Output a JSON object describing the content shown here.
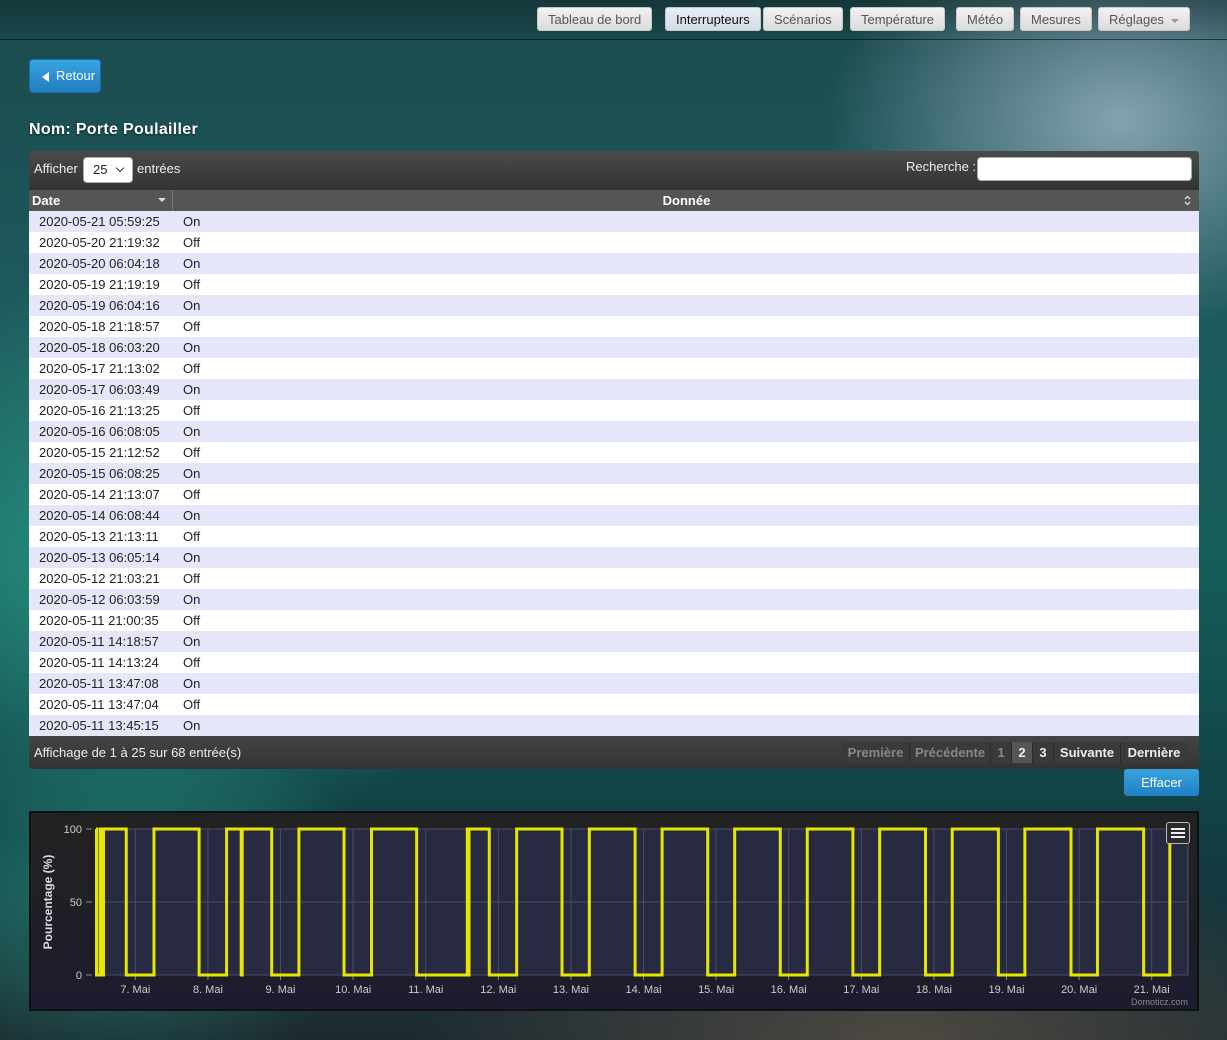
{
  "nav": {
    "items": [
      {
        "label": "Tableau de bord",
        "active": false
      },
      {
        "label": "Interrupteurs",
        "active": true
      },
      {
        "label": "Scénarios",
        "active": false
      },
      {
        "label": "Température",
        "active": false
      },
      {
        "label": "Météo",
        "active": false
      },
      {
        "label": "Mesures",
        "active": false
      },
      {
        "label": "Réglages",
        "active": false,
        "dropdown": true
      }
    ]
  },
  "back_button": {
    "label": "Retour",
    "icon": "caret-left-icon"
  },
  "device": {
    "title": "Nom: Porte Poulailler"
  },
  "table": {
    "length_label_before": "Afficher",
    "length_value": "25",
    "length_label_after": "entrées",
    "search_label": "Recherche :",
    "search_value": "",
    "columns": [
      "Date",
      "Donnée"
    ],
    "rows": [
      [
        "2020-05-21 05:59:25",
        "On"
      ],
      [
        "2020-05-20 21:19:32",
        "Off"
      ],
      [
        "2020-05-20 06:04:18",
        "On"
      ],
      [
        "2020-05-19 21:19:19",
        "Off"
      ],
      [
        "2020-05-19 06:04:16",
        "On"
      ],
      [
        "2020-05-18 21:18:57",
        "Off"
      ],
      [
        "2020-05-18 06:03:20",
        "On"
      ],
      [
        "2020-05-17 21:13:02",
        "Off"
      ],
      [
        "2020-05-17 06:03:49",
        "On"
      ],
      [
        "2020-05-16 21:13:25",
        "Off"
      ],
      [
        "2020-05-16 06:08:05",
        "On"
      ],
      [
        "2020-05-15 21:12:52",
        "Off"
      ],
      [
        "2020-05-15 06:08:25",
        "On"
      ],
      [
        "2020-05-14 21:13:07",
        "Off"
      ],
      [
        "2020-05-14 06:08:44",
        "On"
      ],
      [
        "2020-05-13 21:13:11",
        "Off"
      ],
      [
        "2020-05-13 06:05:14",
        "On"
      ],
      [
        "2020-05-12 21:03:21",
        "Off"
      ],
      [
        "2020-05-12 06:03:59",
        "On"
      ],
      [
        "2020-05-11 21:00:35",
        "Off"
      ],
      [
        "2020-05-11 14:18:57",
        "On"
      ],
      [
        "2020-05-11 14:13:24",
        "Off"
      ],
      [
        "2020-05-11 13:47:08",
        "On"
      ],
      [
        "2020-05-11 13:47:04",
        "Off"
      ],
      [
        "2020-05-11 13:45:15",
        "On"
      ]
    ],
    "info": "Affichage de 1 à 25 sur 68 entrée(s)",
    "pagination": {
      "first": "Première",
      "previous": "Précédente",
      "pages": [
        "1",
        "2",
        "3"
      ],
      "current": "1",
      "next": "Suivante",
      "last": "Dernière"
    }
  },
  "clear_button": {
    "label": "Effacer"
  },
  "chart_data": {
    "type": "line",
    "step": true,
    "ylabel": "Pourcentage (%)",
    "ylim": [
      0,
      100
    ],
    "yticks": [
      "0",
      "50",
      "100"
    ],
    "xlim": [
      "2020-05-06 11:00",
      "2020-05-21 12:00"
    ],
    "xticks": [
      "7. Mai",
      "8. Mai",
      "9. Mai",
      "10. Mai",
      "11. Mai",
      "12. Mai",
      "13. Mai",
      "14. Mai",
      "15. Mai",
      "16. Mai",
      "17. Mai",
      "18. Mai",
      "19. Mai",
      "20. Mai",
      "21. Mai"
    ],
    "series_color": "#e6e600",
    "credit": "Domoticz.com",
    "series": [
      {
        "x": [
          "2020-05-06 11:00",
          "2020-05-06 11:10",
          "2020-05-06 12:20",
          "2020-05-06 12:50",
          "2020-05-06 13:30",
          "2020-05-06 21:00",
          "2020-05-07 06:10",
          "2020-05-07 21:05",
          "2020-05-08 06:10",
          "2020-05-08 11:00",
          "2020-05-08 11:20",
          "2020-05-08 21:05",
          "2020-05-09 06:05",
          "2020-05-09 21:00",
          "2020-05-10 06:05",
          "2020-05-10 21:00",
          "2020-05-11 13:45:15",
          "2020-05-11 13:47:04",
          "2020-05-11 13:47:08",
          "2020-05-11 14:13:24",
          "2020-05-11 14:18:57",
          "2020-05-11 21:00:35",
          "2020-05-12 06:03:59",
          "2020-05-12 21:03:21",
          "2020-05-13 06:05:14",
          "2020-05-13 21:13:11",
          "2020-05-14 06:08:44",
          "2020-05-14 21:13:07",
          "2020-05-15 06:08:25",
          "2020-05-15 21:12:52",
          "2020-05-16 06:08:05",
          "2020-05-16 21:13:25",
          "2020-05-17 06:03:49",
          "2020-05-17 21:13:02",
          "2020-05-18 06:03:20",
          "2020-05-18 21:18:57",
          "2020-05-19 06:04:16",
          "2020-05-19 21:19:19",
          "2020-05-20 06:04:18",
          "2020-05-20 21:19:32",
          "2020-05-21 05:59:25",
          "2020-05-21 12:00"
        ],
        "values": [
          100,
          0,
          100,
          0,
          100,
          0,
          100,
          0,
          100,
          0,
          100,
          0,
          100,
          0,
          100,
          0,
          100,
          0,
          100,
          0,
          100,
          0,
          100,
          0,
          100,
          0,
          100,
          0,
          100,
          0,
          100,
          0,
          100,
          0,
          100,
          0,
          100,
          0,
          100,
          0,
          100,
          100
        ]
      }
    ]
  }
}
